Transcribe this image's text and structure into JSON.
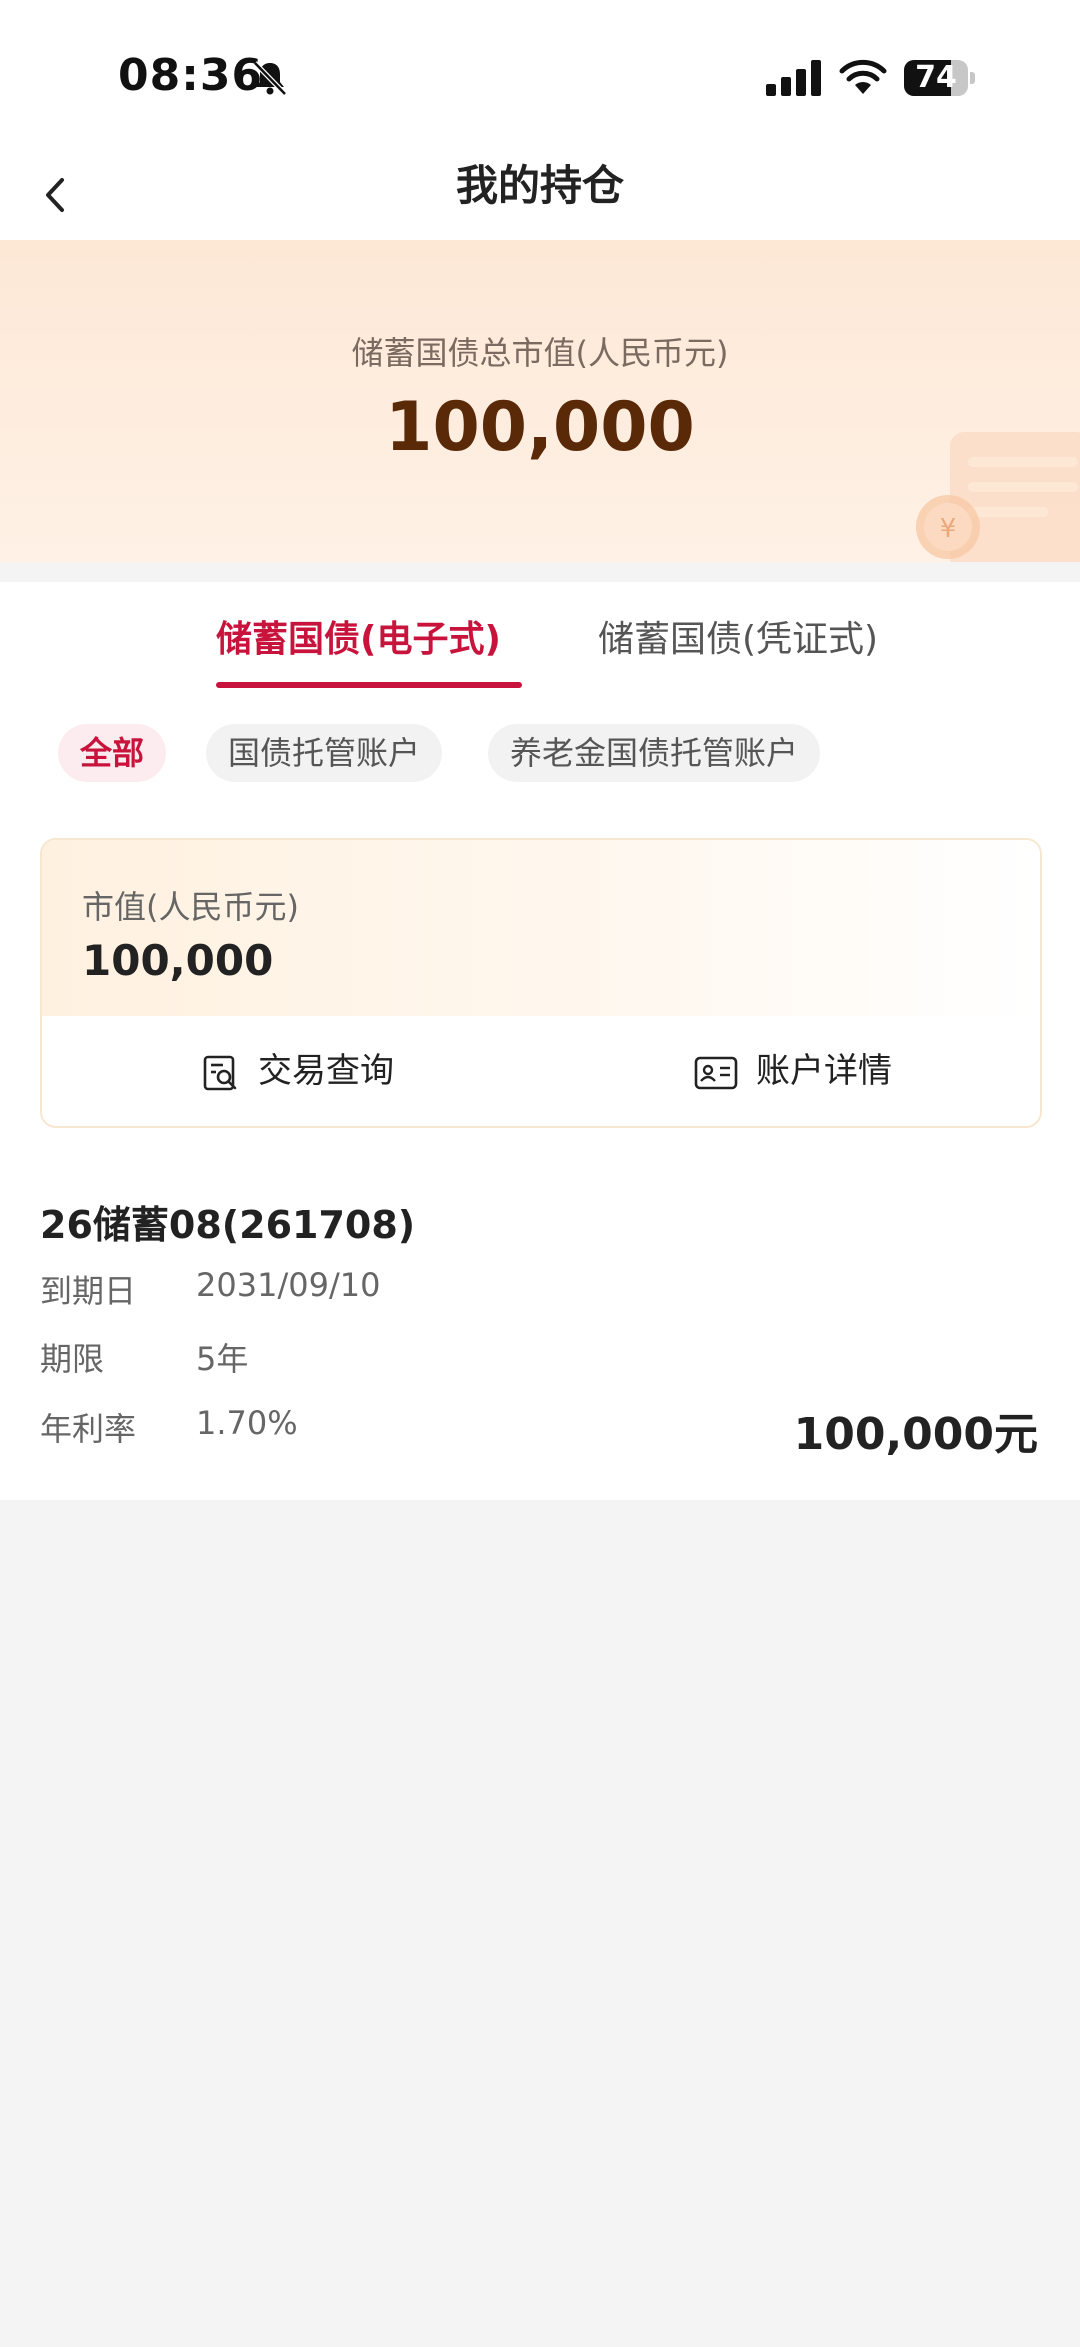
{
  "status": {
    "time": "08:36",
    "battery": "74",
    "battery_level": 0.74,
    "icons": [
      "bell-slash-icon",
      "signal-icon",
      "wifi-icon",
      "battery-icon"
    ]
  },
  "nav": {
    "title": "我的持仓",
    "back_icon": "chevron-left-icon"
  },
  "summary": {
    "label": "储蓄国债总市值(人民币元)",
    "value": "100,000"
  },
  "tabs": [
    {
      "label": "储蓄国债(电子式)",
      "active": true
    },
    {
      "label": "储蓄国债(凭证式)",
      "active": false
    }
  ],
  "filters": [
    {
      "label": "全部",
      "active": true
    },
    {
      "label": "国债托管账户",
      "active": false
    },
    {
      "label": "养老金国债托管账户",
      "active": false
    }
  ],
  "account": {
    "market_value_label": "市值(人民币元)",
    "market_value": "100,000",
    "actions": [
      {
        "label": "交易查询",
        "icon": "search-document-icon"
      },
      {
        "label": "账户详情",
        "icon": "id-card-icon"
      }
    ]
  },
  "holding": {
    "name": "26储蓄08(261708)",
    "rows": [
      {
        "label": "到期日",
        "value": "2031/09/10"
      },
      {
        "label": "期限",
        "value": "5年"
      },
      {
        "label": "年利率",
        "value": "1.70%"
      }
    ],
    "amount": "100,000元"
  },
  "colors": {
    "accent": "#c8143c",
    "hero_value": "#5a2a08",
    "hero_bg": "#fde8d6"
  }
}
